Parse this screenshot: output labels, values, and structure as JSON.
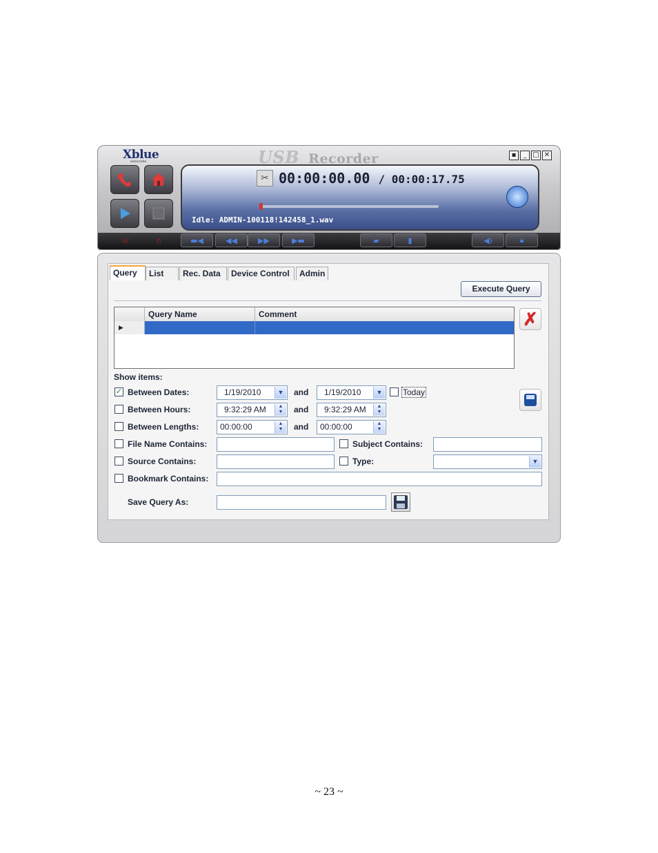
{
  "window": {
    "logo": "Xblue",
    "logo_sub": "networks",
    "title_usb": "USB",
    "title": "Recorder",
    "controls": [
      "restore",
      "minimize",
      "maximize",
      "close"
    ]
  },
  "player": {
    "time_current": "00:00:00.00",
    "time_total": "/ 00:00:17.75",
    "status": "Idle: ADMIN-100118!142458_1.wav",
    "progress": 0.0
  },
  "tabs": [
    {
      "label": "Query",
      "active": true
    },
    {
      "label": "List",
      "active": false
    },
    {
      "label": "Rec. Data",
      "active": false
    },
    {
      "label": "Device Control",
      "active": false
    },
    {
      "label": "Admin",
      "active": false
    }
  ],
  "query": {
    "execute_label": "Execute Query",
    "grid_columns": [
      "Query Name",
      "Comment"
    ],
    "show_items_label": "Show items:",
    "and_label": "and",
    "between_dates": {
      "label": "Between Dates:",
      "checked": true,
      "from": "1/19/2010",
      "to": "1/19/2010"
    },
    "today": {
      "label": "Today",
      "checked": false
    },
    "between_hours": {
      "label": "Between Hours:",
      "checked": false,
      "from": "9:32:29 AM",
      "to": "9:32:29 AM"
    },
    "between_lengths": {
      "label": "Between Lengths:",
      "checked": false,
      "from": "00:00:00",
      "to": "00:00:00"
    },
    "file_name": {
      "label": "File Name Contains:",
      "checked": false,
      "value": ""
    },
    "subject": {
      "label": "Subject Contains:",
      "checked": false,
      "value": ""
    },
    "source": {
      "label": "Source Contains:",
      "checked": false,
      "value": ""
    },
    "type": {
      "label": "Type:",
      "checked": false,
      "value": ""
    },
    "bookmark": {
      "label": "Bookmark Contains:",
      "checked": false,
      "value": ""
    },
    "save_as": {
      "label": "Save Query As:",
      "value": ""
    }
  },
  "footer": {
    "page": "~ 23 ~"
  },
  "colors": {
    "selection": "#3169c6",
    "active_tab": "#f0a83b",
    "delete": "#d22a2a"
  }
}
